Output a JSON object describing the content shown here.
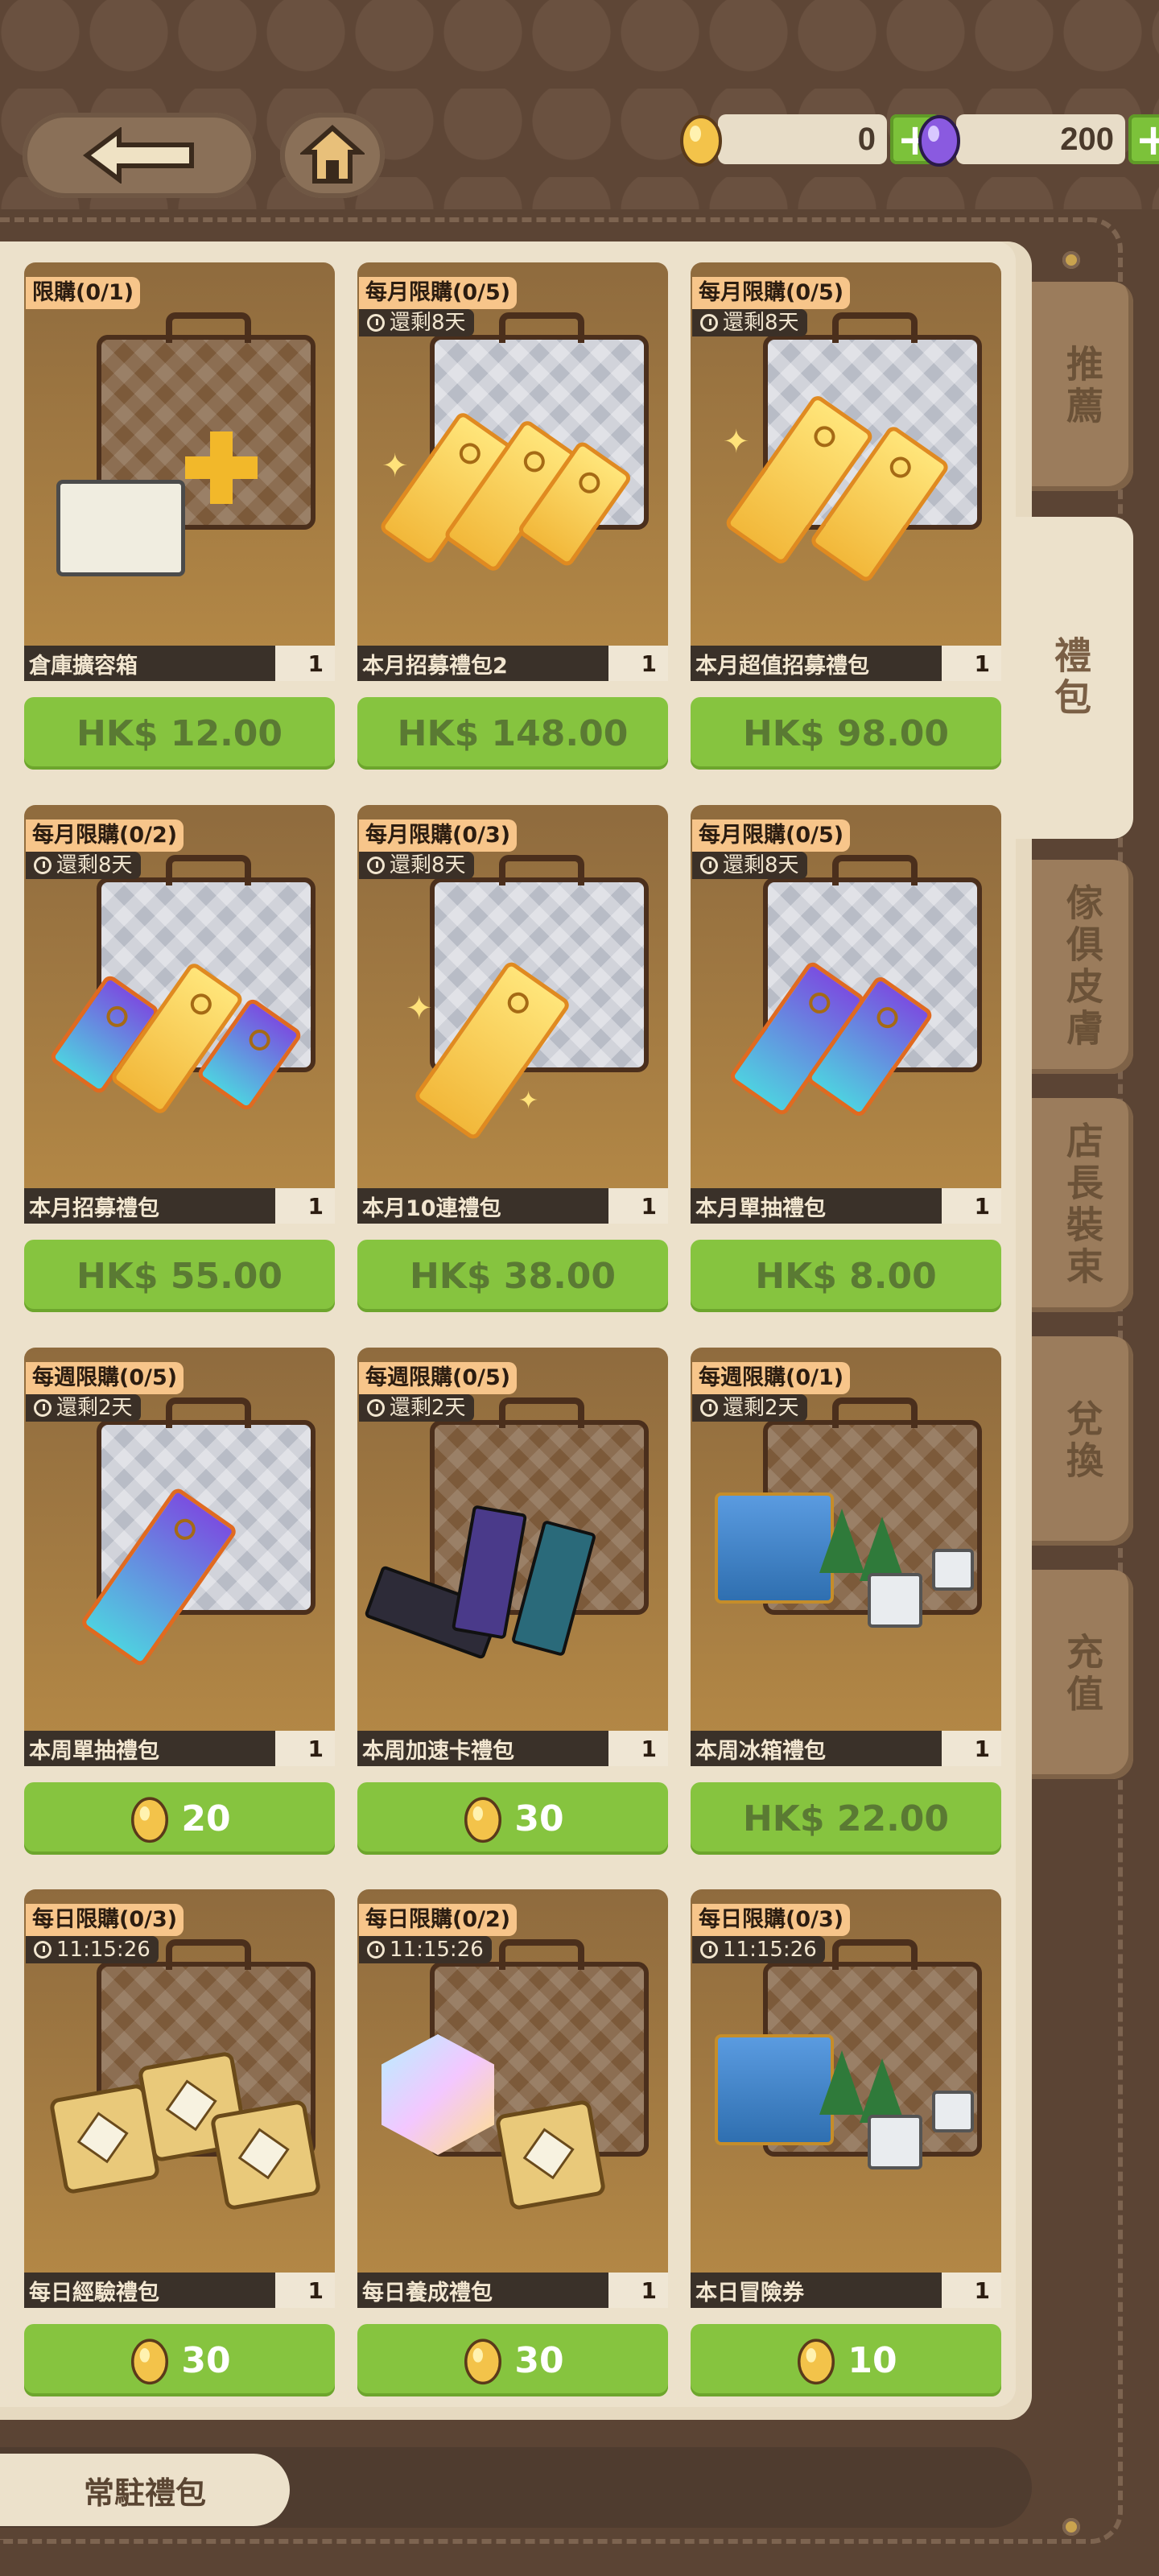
{
  "currency": {
    "gold_amount": "0",
    "purple_amount": "200",
    "plus": "+"
  },
  "side_tabs": [
    {
      "label": "推薦"
    },
    {
      "label": "禮包"
    },
    {
      "label": "傢俱皮膚"
    },
    {
      "label": "店長裝束"
    },
    {
      "label": "兌換"
    },
    {
      "label": "充值"
    }
  ],
  "active_tab": "禮包",
  "items": [
    {
      "limit": "限購(0/1)",
      "timer": "",
      "name": "倉庫擴容箱",
      "count": "1",
      "price": "HK$ 12.00"
    },
    {
      "limit": "每月限購(0/5)",
      "timer": "還剩8天",
      "name": "本月招募禮包2",
      "count": "1",
      "price": "HK$ 148.00"
    },
    {
      "limit": "每月限購(0/5)",
      "timer": "還剩8天",
      "name": "本月超值招募禮包",
      "count": "1",
      "price": "HK$ 98.00"
    },
    {
      "limit": "每月限購(0/2)",
      "timer": "還剩8天",
      "name": "本月招募禮包",
      "count": "1",
      "price": "HK$ 55.00"
    },
    {
      "limit": "每月限購(0/3)",
      "timer": "還剩8天",
      "name": "本月10連禮包",
      "count": "1",
      "price": "HK$ 38.00"
    },
    {
      "limit": "每月限購(0/5)",
      "timer": "還剩8天",
      "name": "本月單抽禮包",
      "count": "1",
      "price": "HK$ 8.00"
    },
    {
      "limit": "每週限購(0/5)",
      "timer": "還剩2天",
      "name": "本周單抽禮包",
      "count": "1",
      "price": "20"
    },
    {
      "limit": "每週限購(0/5)",
      "timer": "還剩2天",
      "name": "本周加速卡禮包",
      "count": "1",
      "price": "30"
    },
    {
      "limit": "每週限購(0/1)",
      "timer": "還剩2天",
      "name": "本周冰箱禮包",
      "count": "1",
      "price": "HK$ 22.00"
    },
    {
      "limit": "每日限購(0/3)",
      "timer": "11:15:26",
      "name": "每日經驗禮包",
      "count": "1",
      "price": "30"
    },
    {
      "limit": "每日限購(0/2)",
      "timer": "11:15:26",
      "name": "每日養成禮包",
      "count": "1",
      "price": "30"
    },
    {
      "limit": "每日限購(0/3)",
      "timer": "11:15:26",
      "name": "本日冒險券",
      "count": "1",
      "price": "10"
    }
  ],
  "bottom_tab": "常駐禮包",
  "colors": {
    "price_button": "#86c43f",
    "limit_tag": "#f7c58a",
    "panel": "#ece1cb",
    "background": "#5b4434"
  },
  "icons": {
    "back": "left-arrow-icon",
    "home": "home-icon",
    "gold": "gold-egg-icon",
    "purple": "purple-egg-icon",
    "timer": "clock-icon"
  }
}
